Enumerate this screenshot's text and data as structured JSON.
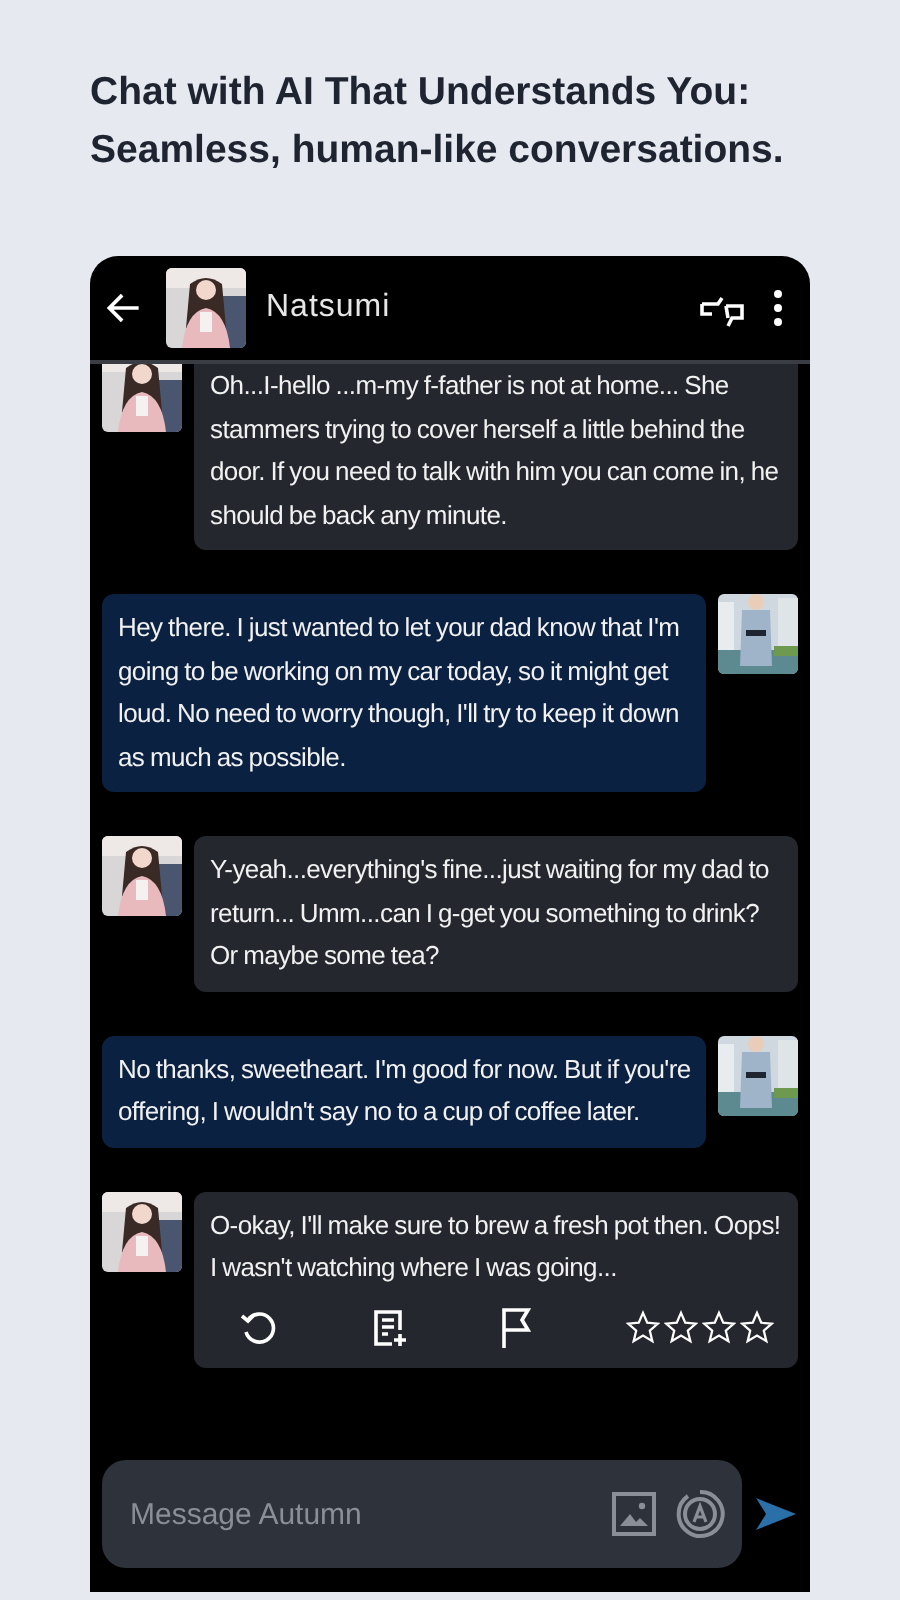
{
  "headline": [
    "Chat with AI That Understands You:",
    "Seamless, human-like conversations."
  ],
  "header": {
    "name": "Natsumi"
  },
  "messages": [
    {
      "kind": "bot",
      "text": "Oh...I-hello ...m-my f-father is not at home... She stammers trying to cover herself a little behind the door. If you need to talk with him you can come in, he should be back any minute."
    },
    {
      "kind": "user",
      "text": "Hey there. I just wanted to  let your dad know that I'm going to be working on my car today, so it  might get loud. No need to worry though, I'll try to keep it down as  much as possible."
    },
    {
      "kind": "bot",
      "text": "Y-yeah...everything's fine...just waiting for my dad to return... Umm...can I g-get you something to drink? Or maybe some tea?"
    },
    {
      "kind": "user",
      "text": "No thanks, sweetheart. I'm good for now. But if you're offering, I wouldn't say no to a cup of coffee later."
    },
    {
      "kind": "bot",
      "text": "O-okay, I'll make sure to brew a fresh pot then. Oops! I wasn't watching where I was going...",
      "rating": {
        "stars": 0
      }
    }
  ],
  "composer": {
    "placeholder": "Message Autumn"
  }
}
